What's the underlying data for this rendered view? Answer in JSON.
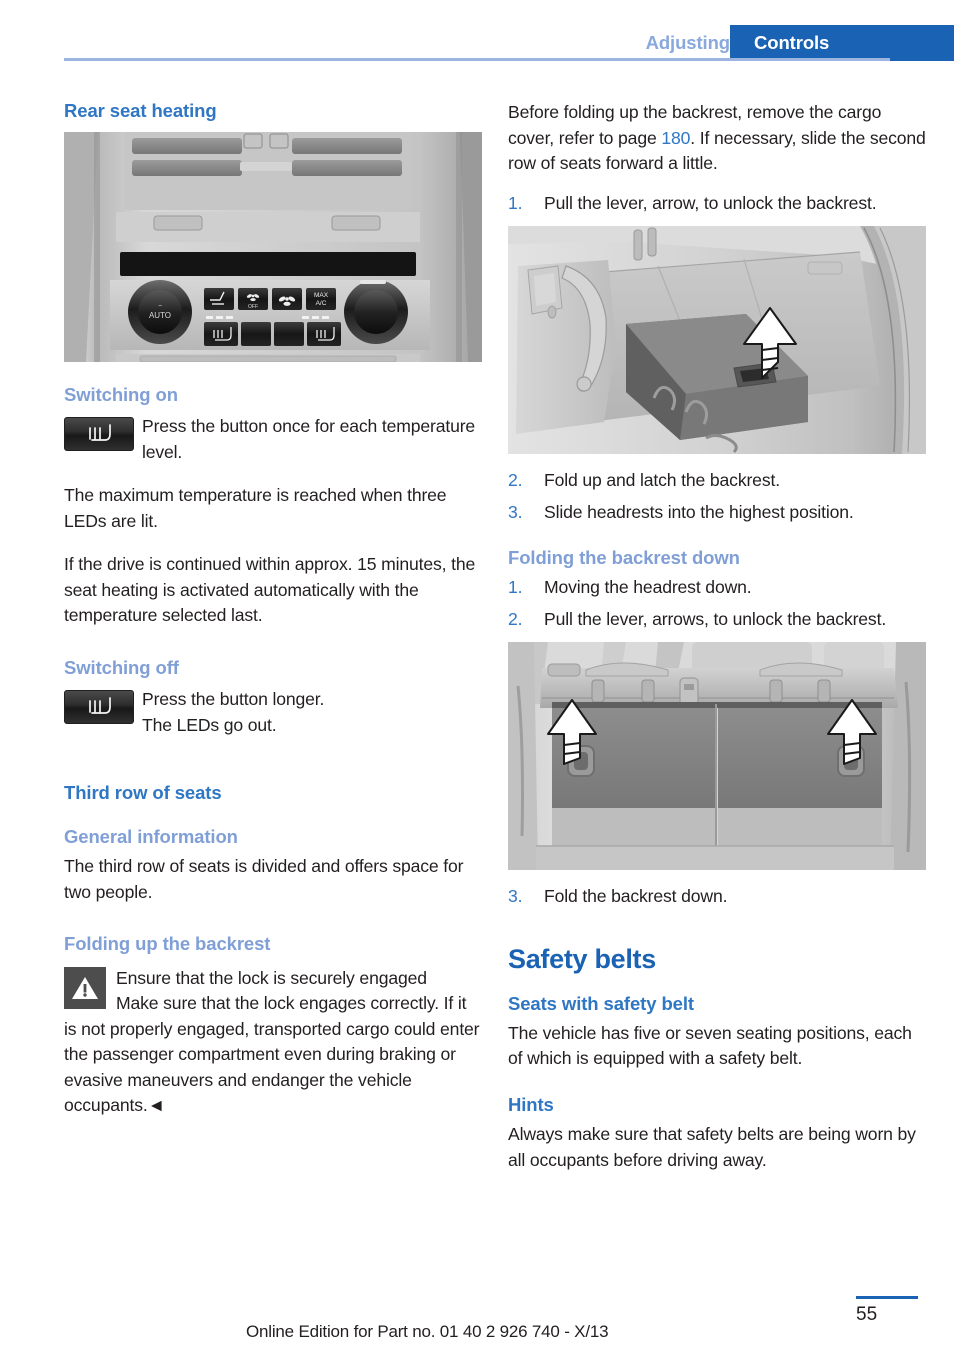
{
  "header": {
    "tab_inactive": "Adjusting",
    "tab_active": "Controls",
    "accent_blue": "#1a62b3",
    "light_blue": "#7f9fd6"
  },
  "left_column": {
    "heading_rear_seat_heating": "Rear seat heating",
    "figure_climate_alt": "climate-control-panel-illustration",
    "subheading_switching_on": "Switching on",
    "switching_on_text": "Press the button once for each temperature level.",
    "para_max_temp": "The maximum temperature is reached when three LEDs are lit.",
    "para_auto_reactivate": "If the drive is continued within approx. 15 minutes, the seat heating is activated automatically with the temperature selected last.",
    "subheading_switching_off": "Switching off",
    "switching_off_line1": "Press the button longer.",
    "switching_off_line2": "The LEDs go out.",
    "heading_third_row": "Third row of seats",
    "subheading_general_information": "General information",
    "para_third_row": "The third row of seats is divided and offers space for two people.",
    "subheading_folding_up": "Folding up the backrest",
    "warning_title": "Ensure that the lock is securely engaged",
    "warning_body": "Make sure that the lock engages correctly. If it is not properly engaged, transported cargo could enter the passenger compartment even during braking or evasive maneuvers and endanger the vehicle occupants.◄"
  },
  "right_column": {
    "intro_part1": "Before folding up the backrest, remove the cargo cover, refer to page ",
    "intro_page_ref": "180",
    "intro_part2": ". If necessary, slide the second row of seats forward a little.",
    "folding_up_steps": [
      {
        "num": "1.",
        "text": "Pull the lever, arrow, to unlock the backrest."
      }
    ],
    "figure_cargo_alt": "cargo-area-backrest-unlock-illustration",
    "folding_up_steps_after": [
      {
        "num": "2.",
        "text": "Fold up and latch the backrest."
      },
      {
        "num": "3.",
        "text": "Slide headrests into the highest position."
      }
    ],
    "subheading_folding_down": "Folding the backrest down",
    "folding_down_steps": [
      {
        "num": "1.",
        "text": "Moving the headrest down."
      },
      {
        "num": "2.",
        "text": "Pull the lever, arrows, to unlock the backrest."
      }
    ],
    "figure_seats_alt": "third-row-seat-backrests-illustration",
    "folding_down_steps_after": [
      {
        "num": "3.",
        "text": "Fold the backrest down."
      }
    ],
    "heading_safety_belts": "Safety belts",
    "subheading_seats_with_safety_belt": "Seats with safety belt",
    "para_seating_positions": "The vehicle has five or seven seating positions, each of which is equipped with a safety belt.",
    "subheading_hints": "Hints",
    "para_hints": "Always make sure that safety belts are being worn by all occupants before driving away."
  },
  "climate_panel": {
    "auto_label": "AUTO",
    "off_label": "OFF",
    "max_label": "MAX",
    "ac_label": "A/C"
  },
  "footer": {
    "edition_text": "Online Edition for Part no. 01 40 2 926 740 - X/13",
    "page_number": "55"
  }
}
